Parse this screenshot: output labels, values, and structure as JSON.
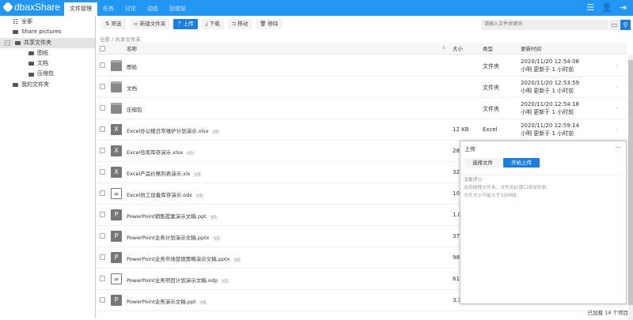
{
  "app": {
    "logo": "dbaxShare",
    "tabs": [
      "文件管理",
      "任务",
      "讨论",
      "动态",
      "回收站"
    ],
    "active_tab": 0,
    "icons": [
      "menu-icon",
      "user-icon",
      "logout-icon"
    ]
  },
  "sidebar": {
    "items": [
      {
        "label": "全部",
        "level": 0,
        "icon": "list-icon"
      },
      {
        "label": "Share pictures",
        "level": 0,
        "icon": "folder-icon"
      },
      {
        "label": "共享文件夹",
        "level": 0,
        "icon": "folder-icon",
        "selected": true,
        "expanded": true
      },
      {
        "label": "图纸",
        "level": 1,
        "icon": "folder-icon"
      },
      {
        "label": "文档",
        "level": 1,
        "icon": "folder-icon"
      },
      {
        "label": "压缩包",
        "level": 1,
        "icon": "folder-icon"
      },
      {
        "label": "我的文件夹",
        "level": 0,
        "icon": "folder-icon"
      }
    ]
  },
  "toolbar": {
    "filter": "筛选",
    "new_folder": "新建文件夹",
    "upload": "上传",
    "download": "下载",
    "move": "移动",
    "remove": "移除"
  },
  "search": {
    "placeholder": "请输入文件关键词"
  },
  "breadcrumb": "全部 / 共享文件夹",
  "table": {
    "headers": {
      "name": "名称",
      "sort": "⇅",
      "size": "大小",
      "type": "类型",
      "time": "更新时间"
    },
    "rows": [
      {
        "name": "图纸",
        "kind": "folder",
        "size": "",
        "type": "文件夹",
        "time": "2020/11/20 12:54:06",
        "by": "小明 更新于 1 小时前"
      },
      {
        "name": "文档",
        "kind": "folder",
        "size": "",
        "type": "文件夹",
        "time": "2020/11/20 12:53:59",
        "by": "小明 更新于 1 小时前"
      },
      {
        "name": "压缩包",
        "kind": "folder",
        "size": "",
        "type": "文件夹",
        "time": "2020/11/20 12:54:18",
        "by": "小明 更新于 1 小时前"
      },
      {
        "name": "Excel办公楼日常维护计划演示.xlsx",
        "kind": "excel",
        "ver": "v1",
        "size": "12 KB",
        "type": "Excel",
        "time": "2020/11/20 12:59:14",
        "by": "小明 更新于 1 小时前"
      },
      {
        "name": "Excel仓库库存演示.xlsx",
        "kind": "excel",
        "ver": "v1",
        "size": "28"
      },
      {
        "name": "Excel产品价格列表演示.xls",
        "kind": "excel",
        "ver": "v1",
        "size": "32"
      },
      {
        "name": "Excel员工设备库存演示.ods",
        "kind": "ods",
        "ver": "v1",
        "size": "10"
      },
      {
        "name": "PowerPoint销售提案演示文稿.ppt",
        "kind": "ppt",
        "ver": "v1",
        "size": "1.0"
      },
      {
        "name": "PowerPoint业务计划演示文稿.pptx",
        "kind": "ppt",
        "ver": "v1",
        "size": "37"
      },
      {
        "name": "PowerPoint业务市场营销策略演示文稿.pptx",
        "kind": "ppt",
        "ver": "v1",
        "size": "98"
      },
      {
        "name": "PowerPoint业务项目计划演示文稿.odp",
        "kind": "ods",
        "ver": "v1",
        "size": "61"
      },
      {
        "name": "PowerPoint业务演示文稿.ppt",
        "kind": "ppt",
        "ver": "v1",
        "size": "3.3"
      }
    ]
  },
  "status": "已加载 14 个项目",
  "upload_popup": {
    "title": "上传",
    "minimize": "—",
    "choose": "选择文件",
    "start": "开始上传",
    "tips": [
      "温馨提示:",
      "支持拖拽文件夹、文件到此窗口添加列表;",
      "文件大小不能大于100MB;"
    ]
  },
  "colors": {
    "brand": "#2196f3",
    "primary_button": "#1a7fe0"
  }
}
